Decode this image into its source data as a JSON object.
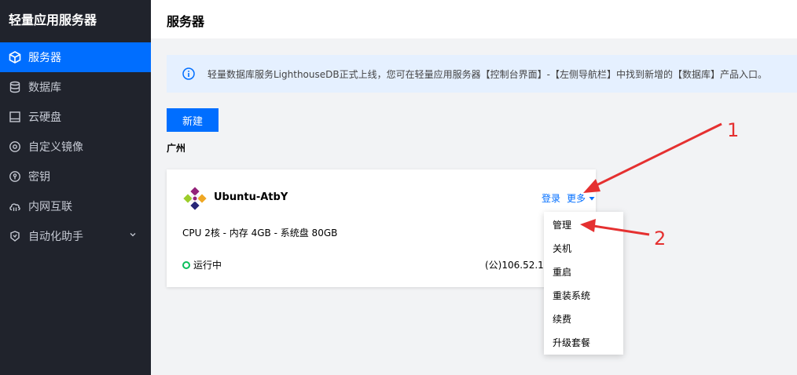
{
  "sidebar": {
    "brand": "轻量应用服务器",
    "items": [
      {
        "label": "服务器",
        "icon": "cube-icon",
        "active": true
      },
      {
        "label": "数据库",
        "icon": "database-icon"
      },
      {
        "label": "云硬盘",
        "icon": "disk-icon"
      },
      {
        "label": "自定义镜像",
        "icon": "image-disc-icon"
      },
      {
        "label": "密钥",
        "icon": "key-icon"
      },
      {
        "label": "内网互联",
        "icon": "cloud-link-icon"
      },
      {
        "label": "自动化助手",
        "icon": "automation-icon",
        "has_children": true
      }
    ]
  },
  "header": {
    "title": "服务器"
  },
  "notice": {
    "icon": "info-icon",
    "text": "轻量数据库服务LighthouseDB正式上线，您可在轻量应用服务器【控制台界面】-【左侧导航栏】中找到新增的【数据库】产品入口。"
  },
  "toolbar": {
    "create_label": "新建"
  },
  "region": "广州",
  "instance": {
    "name": "Ubuntu-AtbY",
    "logo": "ubuntu-logo",
    "login_label": "登录",
    "more_label": "更多",
    "spec": "CPU 2核 - 内存 4GB - 系统盘 80GB",
    "status": "运行中",
    "ip": "(公)106.52.16"
  },
  "more_menu": {
    "items": [
      "管理",
      "关机",
      "重启",
      "重装系统",
      "续费",
      "升级套餐"
    ]
  },
  "annotations": {
    "label_1": "1",
    "label_2": "2",
    "color": "#e53030"
  },
  "colors": {
    "accent": "#006eff",
    "sidebar_bg": "#20232c",
    "notice_bg": "#e5f0ff",
    "running": "#0abf5b"
  }
}
